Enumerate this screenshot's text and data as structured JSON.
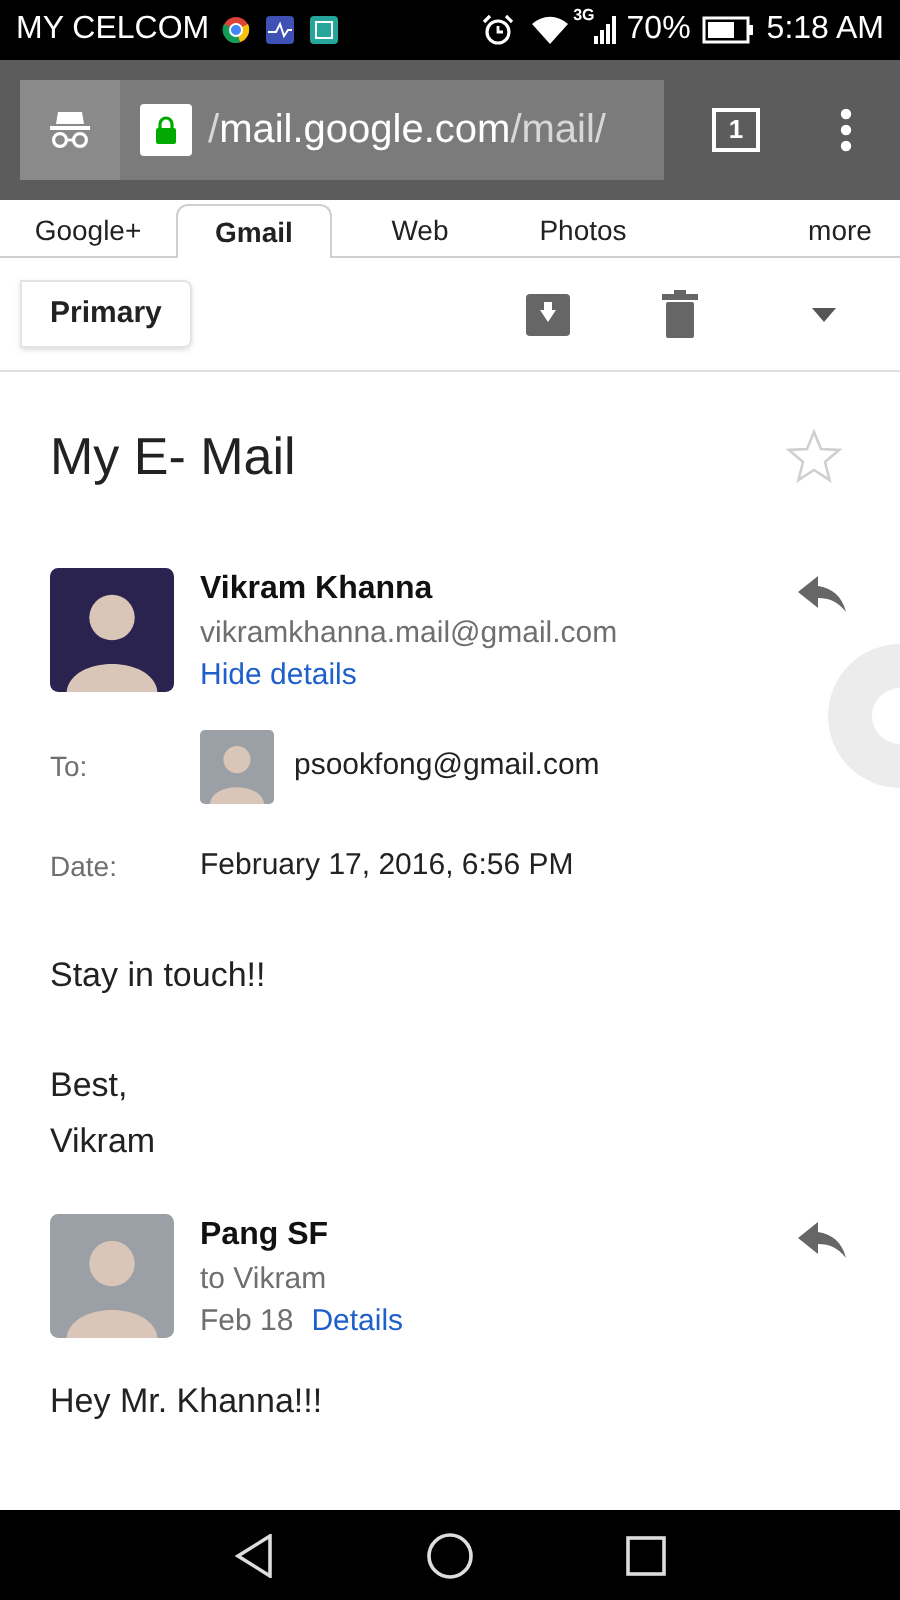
{
  "status_bar": {
    "carrier": "MY CELCOM",
    "network": "3G",
    "battery": "70%",
    "time": "5:18 AM"
  },
  "browser": {
    "url_prefix": "/",
    "url_host": "mail.google.com",
    "url_path": "/mail/",
    "tab_count": "1"
  },
  "tabs": [
    {
      "label": "Google+",
      "selected": false
    },
    {
      "label": "Gmail",
      "selected": true
    },
    {
      "label": "Web",
      "selected": false
    },
    {
      "label": "Photos",
      "selected": false
    },
    {
      "label": "more",
      "selected": false
    }
  ],
  "toolbar": {
    "label": "Primary"
  },
  "subject": {
    "title": "My E- Mail",
    "starred": false
  },
  "messages": [
    {
      "sender": "Vikram Khanna",
      "line_2": "vikramkhanna.mail@gmail.com",
      "link": "Hide details",
      "details": [
        {
          "label": "To:",
          "value": "psookfong@gmail.com",
          "avatar": true
        },
        {
          "label": "Date:",
          "value": "February 17, 2016, 6:56 PM",
          "avatar": false
        }
      ],
      "body": [
        "Stay in touch!!",
        "Best,\nVikram"
      ]
    },
    {
      "sender": "Pang SF",
      "line_2": "to Vikram",
      "date": "Feb 18",
      "link": "Details",
      "body": [
        "Hey Mr. Khanna!!!"
      ]
    }
  ]
}
